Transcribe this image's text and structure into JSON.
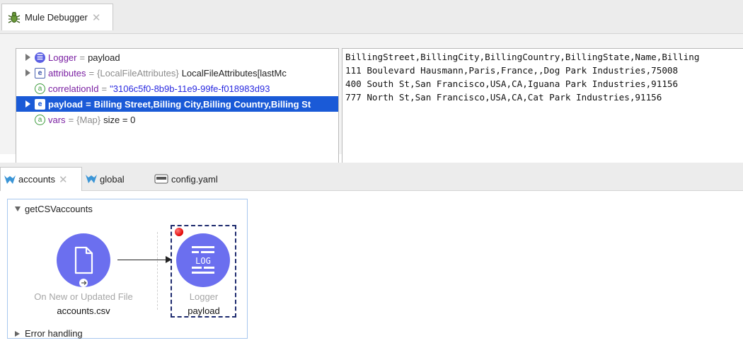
{
  "debugger": {
    "tab_label": "Mule Debugger",
    "tree": [
      {
        "icon": "logger",
        "name": "Logger",
        "eq": "=",
        "value": "payload",
        "expandable": true,
        "selected": false
      },
      {
        "icon": "e",
        "name": "attributes",
        "eq": "=",
        "type": "{LocalFileAttributes}",
        "value": "LocalFileAttributes[lastMc",
        "expandable": true,
        "selected": false
      },
      {
        "icon": "a",
        "name": "correlationId",
        "eq": "=",
        "value": "\"3106c5f0-8b9b-11e9-99fe-f018983d93",
        "expandable": false,
        "selected": false
      },
      {
        "icon": "e",
        "name": "payload",
        "eq": "=",
        "value": "Billing Street,Billing City,Billing Country,Billing St",
        "expandable": true,
        "selected": true
      },
      {
        "icon": "a",
        "name": "vars",
        "eq": "=",
        "type": "{Map}",
        "value": "size = 0",
        "expandable": false,
        "selected": false
      }
    ],
    "value_lines": [
      "BillingStreet,BillingCity,BillingCountry,BillingState,Name,Billing",
      "111 Boulevard Hausmann,Paris,France,,Dog Park Industries,75008",
      "400 South St,San Francisco,USA,CA,Iguana Park Industries,91156",
      "777 North St,San Francisco,USA,CA,Cat Park Industries,91156"
    ]
  },
  "editor": {
    "tabs": [
      {
        "label": "accounts",
        "active": true
      },
      {
        "label": "global",
        "active": false
      },
      {
        "label": "config.yaml",
        "active": false
      }
    ],
    "flow": {
      "name": "getCSVaccounts",
      "source": {
        "caption": "On New or Updated File",
        "detail": "accounts.csv"
      },
      "logger": {
        "caption": "Logger",
        "detail": "payload",
        "icon_text": "LOG"
      },
      "error_handling": "Error handling"
    }
  },
  "colors": {
    "selection": "#1a5ad7",
    "component": "#6b6fef",
    "breakpoint": "#e00000",
    "flow_border": "#a7c7ee"
  }
}
